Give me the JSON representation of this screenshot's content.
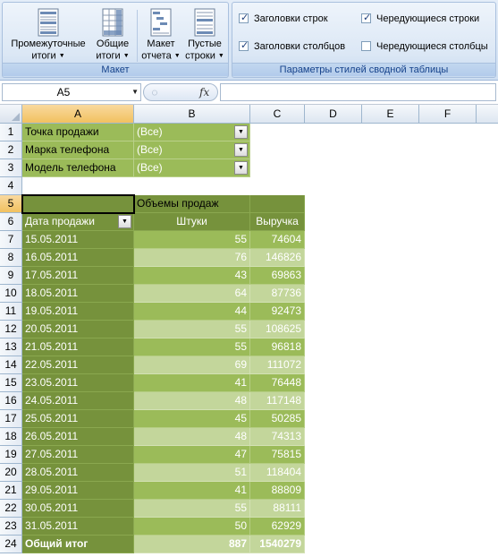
{
  "ribbon": {
    "layout_group": {
      "caption": "Макет",
      "buttons": [
        {
          "line1": "Промежуточные",
          "line2": "итоги",
          "icon": "subtotals-icon"
        },
        {
          "line1": "Общие",
          "line2": "итоги",
          "icon": "grand-totals-icon"
        },
        {
          "line1": "Макет",
          "line2": "отчета",
          "icon": "report-layout-icon"
        },
        {
          "line1": "Пустые",
          "line2": "строки",
          "icon": "blank-rows-icon"
        }
      ]
    },
    "style_options_group": {
      "caption": "Параметры стилей сводной таблицы",
      "options": [
        {
          "label": "Заголовки строк",
          "checked": true
        },
        {
          "label": "Чередующиеся строки",
          "checked": true
        },
        {
          "label": "Заголовки столбцов",
          "checked": true
        },
        {
          "label": "Чередующиеся столбцы",
          "checked": false
        }
      ]
    }
  },
  "formula_bar": {
    "name_box": "A5",
    "fx_label": "fx",
    "formula": ""
  },
  "sheet": {
    "columns": [
      "A",
      "B",
      "C",
      "D",
      "E",
      "F"
    ],
    "selected_column": "A",
    "selected_row": "5",
    "row_numbers": [
      "1",
      "2",
      "3",
      "4",
      "5",
      "6",
      "7",
      "8",
      "9",
      "10",
      "11",
      "12",
      "13",
      "14",
      "15",
      "16",
      "17",
      "18",
      "19",
      "20",
      "21",
      "22",
      "23",
      "24"
    ],
    "filters": [
      {
        "label": "Точка продажи",
        "value": "(Все)"
      },
      {
        "label": "Марка телефона",
        "value": "(Все)"
      },
      {
        "label": "Модель телефона",
        "value": "(Все)"
      }
    ],
    "pivot": {
      "values_header": "Объемы продаж",
      "row_field": "Дата продажи",
      "col_units": "Штуки",
      "col_revenue": "Выручка",
      "rows": [
        {
          "date": "15.05.2011",
          "units": "55",
          "revenue": "74604"
        },
        {
          "date": "16.05.2011",
          "units": "76",
          "revenue": "146826"
        },
        {
          "date": "17.05.2011",
          "units": "43",
          "revenue": "69863"
        },
        {
          "date": "18.05.2011",
          "units": "64",
          "revenue": "87736"
        },
        {
          "date": "19.05.2011",
          "units": "44",
          "revenue": "92473"
        },
        {
          "date": "20.05.2011",
          "units": "55",
          "revenue": "108625"
        },
        {
          "date": "21.05.2011",
          "units": "55",
          "revenue": "96818"
        },
        {
          "date": "22.05.2011",
          "units": "69",
          "revenue": "111072"
        },
        {
          "date": "23.05.2011",
          "units": "41",
          "revenue": "76448"
        },
        {
          "date": "24.05.2011",
          "units": "48",
          "revenue": "117148"
        },
        {
          "date": "25.05.2011",
          "units": "45",
          "revenue": "50285"
        },
        {
          "date": "26.05.2011",
          "units": "48",
          "revenue": "74313"
        },
        {
          "date": "27.05.2011",
          "units": "47",
          "revenue": "75815"
        },
        {
          "date": "28.05.2011",
          "units": "51",
          "revenue": "118404"
        },
        {
          "date": "29.05.2011",
          "units": "41",
          "revenue": "88809"
        },
        {
          "date": "30.05.2011",
          "units": "55",
          "revenue": "88111"
        },
        {
          "date": "31.05.2011",
          "units": "50",
          "revenue": "62929"
        }
      ],
      "total": {
        "label": "Общий итог",
        "units": "887",
        "revenue": "1540279"
      }
    }
  }
}
